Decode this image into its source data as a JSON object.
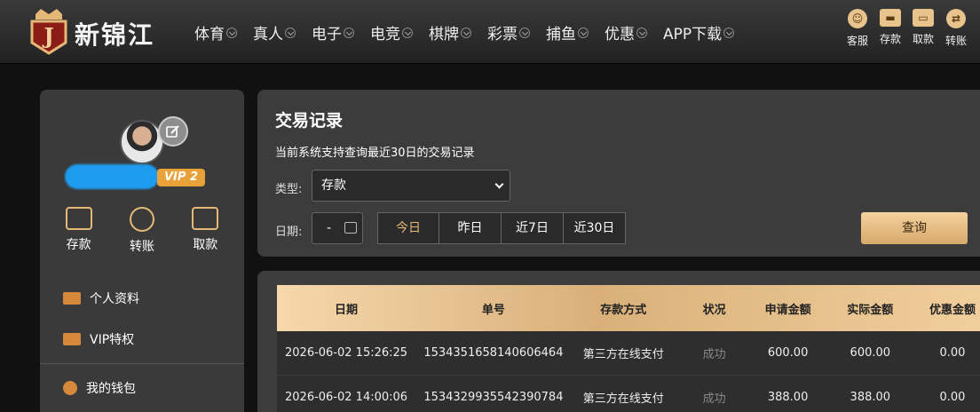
{
  "brand": {
    "name": "新锦江"
  },
  "nav": [
    {
      "label": "体育"
    },
    {
      "label": "真人"
    },
    {
      "label": "电子"
    },
    {
      "label": "电竞"
    },
    {
      "label": "棋牌"
    },
    {
      "label": "彩票"
    },
    {
      "label": "捕鱼"
    },
    {
      "label": "优惠"
    },
    {
      "label": "APP下载"
    }
  ],
  "quick_links": [
    {
      "label": "客服",
      "icon": "service-icon"
    },
    {
      "label": "存款",
      "icon": "deposit-icon"
    },
    {
      "label": "取款",
      "icon": "withdraw-icon"
    },
    {
      "label": "转账",
      "icon": "transfer-icon"
    }
  ],
  "profile": {
    "vip": "VIP 2"
  },
  "side_actions": [
    {
      "label": "存款"
    },
    {
      "label": "转账"
    },
    {
      "label": "取款"
    }
  ],
  "menu": [
    {
      "label": "个人资料"
    },
    {
      "label": "VIP特权"
    },
    {
      "label": "我的钱包"
    }
  ],
  "panel": {
    "title": "交易记录",
    "subtitle": "当前系统支持查询最近30日的交易记录",
    "type_label": "类型:",
    "type_value": "存款",
    "date_label": "日期:",
    "date_value": "-",
    "quick_dates": [
      "今日",
      "昨日",
      "近7日",
      "近30日"
    ],
    "query_label": "查询"
  },
  "table": {
    "headers": [
      "日期",
      "单号",
      "存款方式",
      "状况",
      "申请金额",
      "实际金额",
      "优惠金额"
    ],
    "rows": [
      [
        "2026-06-02 15:26:25",
        "1534351658140606464",
        "第三方在线支付",
        "成功",
        "600.00",
        "600.00",
        "0.00"
      ],
      [
        "2026-06-02 14:00:06",
        "1534329935542390784",
        "第三方在线支付",
        "成功",
        "388.00",
        "388.00",
        "0.00"
      ]
    ]
  },
  "colors": {
    "accent": "#e6b878",
    "vip": "#e9a23a",
    "header_gold": "#d9b07a"
  }
}
